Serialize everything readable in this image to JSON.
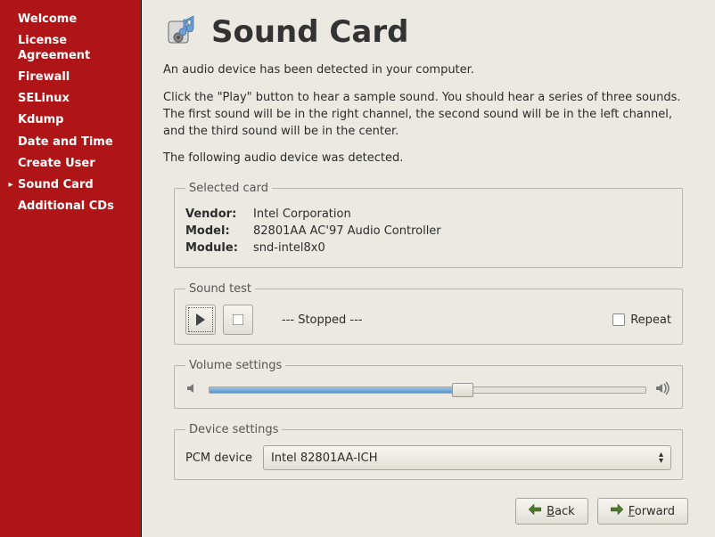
{
  "sidebar": {
    "items": [
      {
        "label": "Welcome",
        "active": false
      },
      {
        "label": "License Agreement",
        "active": false
      },
      {
        "label": "Firewall",
        "active": false
      },
      {
        "label": "SELinux",
        "active": false
      },
      {
        "label": "Kdump",
        "active": false
      },
      {
        "label": "Date and Time",
        "active": false
      },
      {
        "label": "Create User",
        "active": false
      },
      {
        "label": "Sound Card",
        "active": true
      },
      {
        "label": "Additional CDs",
        "active": false
      }
    ]
  },
  "page": {
    "title": "Sound Card",
    "intro1": "An audio device has been detected in your computer.",
    "intro2": "Click the \"Play\" button to hear a sample sound.  You should hear a series of three sounds.  The first sound will be in the right channel, the second sound will be in the left channel, and the third sound will be in the center.",
    "intro3": "The following audio device was detected."
  },
  "selected_card": {
    "legend": "Selected card",
    "vendor_label": "Vendor:",
    "vendor_value": "Intel Corporation",
    "model_label": "Model:",
    "model_value": "82801AA AC'97 Audio Controller",
    "module_label": "Module:",
    "module_value": "snd-intel8x0"
  },
  "sound_test": {
    "legend": "Sound test",
    "status": "--- Stopped ---",
    "repeat_label": "Repeat",
    "repeat_checked": false
  },
  "volume": {
    "legend": "Volume settings",
    "percent": 58
  },
  "device": {
    "legend": "Device settings",
    "label": "PCM device",
    "selected": "Intel 82801AA-ICH"
  },
  "footer": {
    "back": "Back",
    "forward": "Forward"
  }
}
